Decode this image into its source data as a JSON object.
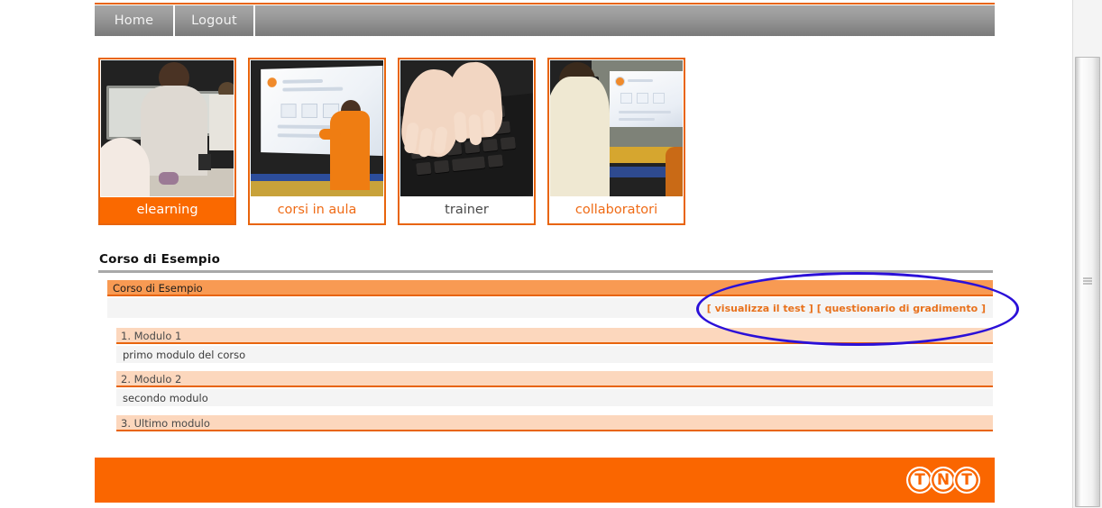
{
  "nav": {
    "items": [
      {
        "label": "Home"
      },
      {
        "label": "Logout"
      }
    ]
  },
  "thumbnails": [
    {
      "caption": "elearning",
      "state": "active",
      "scene": "computer-lab"
    },
    {
      "caption": "corsi in aula",
      "state": "link",
      "scene": "classroom-projector"
    },
    {
      "caption": "trainer",
      "state": "muted",
      "scene": "hands-keyboard"
    },
    {
      "caption": "collaboratori",
      "state": "link",
      "scene": "student-screen"
    }
  ],
  "course": {
    "page_title": "Corso di Esempio",
    "header_label": "Corso di Esempio",
    "links": [
      {
        "label": "[ visualizza il test ]"
      },
      {
        "label": "[ questionario di gradimento ]"
      }
    ],
    "modules": [
      {
        "title": "1. Modulo 1",
        "description": "primo modulo del corso"
      },
      {
        "title": "2. Modulo 2",
        "description": "secondo modulo"
      },
      {
        "title": "3. Ultimo modulo",
        "description": ""
      }
    ]
  },
  "footer": {
    "logo": {
      "letters": [
        "T",
        "N",
        "T"
      ],
      "name": "tnt-logo"
    }
  },
  "annotation": {
    "shape": "ellipse",
    "color": "#2b10d8",
    "targets": "course-action-links"
  },
  "colors": {
    "brand_orange": "#fa6600",
    "rule_orange": "#e8640c",
    "header_orange": "#f89a53",
    "module_peach": "#fcd7bd",
    "row_gray": "#f4f4f4",
    "nav_gray": "#8a8a8a",
    "link_orange": "#e8711c",
    "annotation_blue": "#2b10d8"
  }
}
